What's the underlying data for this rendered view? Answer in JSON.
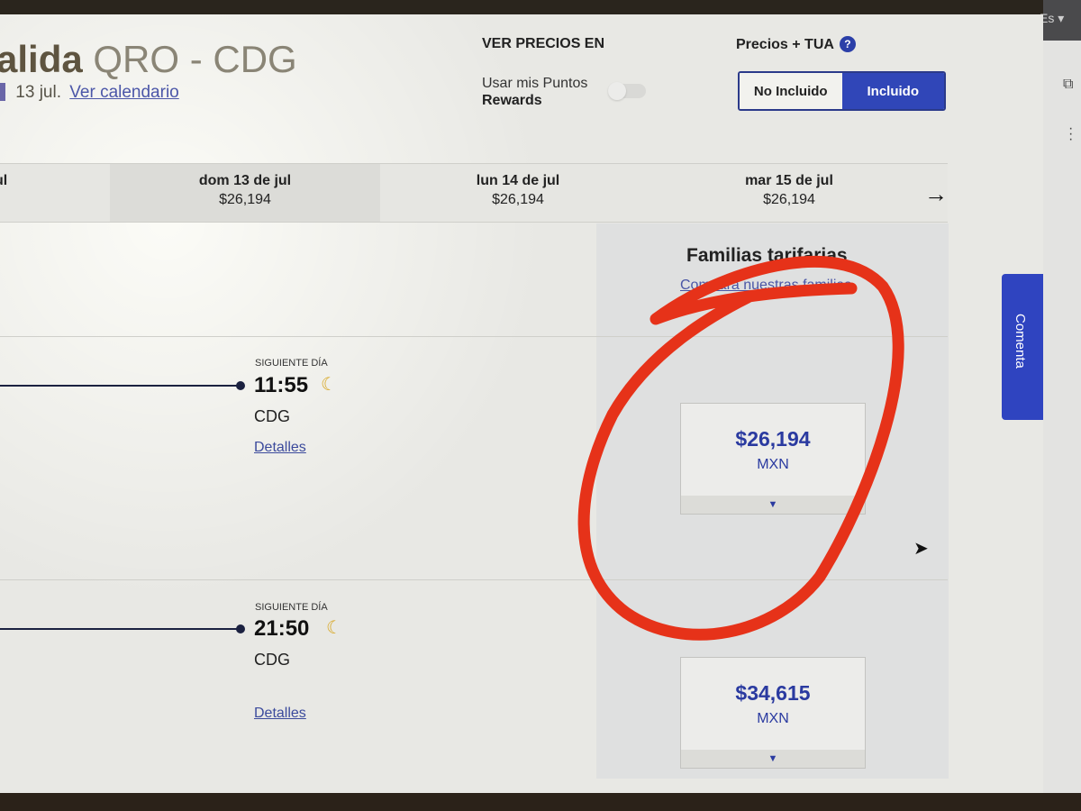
{
  "header": {
    "title_bold": "alida",
    "title_route": "QRO - CDG",
    "date_text": "13 jul.",
    "calendar_link": "Ver calendario"
  },
  "price_options": {
    "title": "VER PRECIOS EN",
    "points_line1": "Usar mis Puntos",
    "points_line2": "Rewards",
    "points_enabled": false
  },
  "tua": {
    "label": "Precios + TUA",
    "help_icon": "?",
    "options": [
      "No Incluido",
      "Incluido"
    ],
    "selected": "Incluido"
  },
  "date_strip": {
    "cells": [
      {
        "day": "ul",
        "price": ""
      },
      {
        "day": "dom 13 de jul",
        "price": "$26,194"
      },
      {
        "day": "lun 14 de jul",
        "price": "$26,194"
      },
      {
        "day": "mar 15 de jul",
        "price": "$26,194"
      }
    ],
    "next_arrow": "→"
  },
  "fare_families": {
    "title": "Familias tarifarias",
    "compare_link": "Compara nuestras familias"
  },
  "flights": [
    {
      "next_day": "SIGUIENTE DÍA",
      "arrival": "11:55",
      "airport": "CDG",
      "details": "Detalles",
      "price": "$26,194",
      "currency": "MXN"
    },
    {
      "next_day": "SIGUIENTE DÍA",
      "arrival": "21:50",
      "airport": "CDG",
      "details": "Detalles",
      "price": "$34,615",
      "currency": "MXN"
    }
  ],
  "feedback": {
    "label": "Comenta"
  },
  "sidebar": {
    "lang": "Es"
  },
  "icons": {
    "moon": "moon-icon",
    "caret": "caret-down-icon",
    "external": "external-link-icon",
    "more": "more-vertical-icon"
  },
  "colors": {
    "brand_blue": "#3046b8",
    "link_blue": "#3b4a9c",
    "annotation_red": "#e63219"
  }
}
